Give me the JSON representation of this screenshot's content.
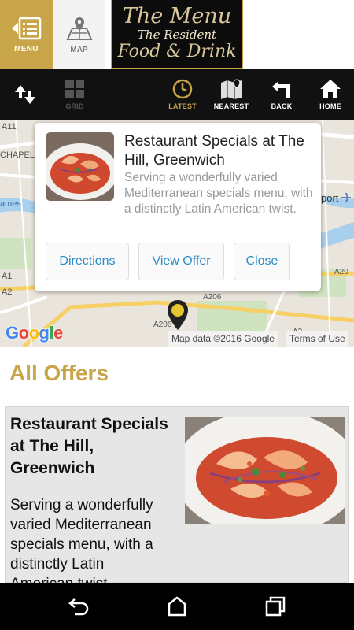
{
  "header": {
    "menu_label": "MENU",
    "map_label": "MAP",
    "logo": {
      "line1": "The Menu",
      "line2": "The Resident",
      "line3": "Food & Drink"
    }
  },
  "toolbar": {
    "grid_label": "GRID",
    "latest_label": "LATEST",
    "nearest_label": "NEAREST",
    "back_label": "BACK",
    "home_label": "HOME"
  },
  "map": {
    "labels": [
      "A11",
      "CHAPEL",
      "ames",
      "A1",
      "A2",
      "port",
      "A206",
      "A2",
      "A206",
      "A20"
    ],
    "google": [
      "G",
      "o",
      "o",
      "g",
      "l",
      "e"
    ],
    "google_colors": [
      "#4285f4",
      "#ea4335",
      "#fbbc05",
      "#4285f4",
      "#34a853",
      "#ea4335"
    ],
    "map_data": "Map data ©2016 Google",
    "terms": "Terms of Use"
  },
  "popup": {
    "title": "Restaurant Specials at The Hill, Greenwich",
    "description": "Serving a wonderfully varied Mediterranean specials menu, with a distinctly Latin American twist.",
    "directions": "Directions",
    "view_offer": "View Offer",
    "close": "Close"
  },
  "offers": {
    "section_title": "All Offers",
    "items": [
      {
        "title": "Restaurant Specials at The Hill, Greenwich",
        "description": "Serving a wonderfully varied Mediterranean specials menu, with a distinctly Latin American twist."
      }
    ]
  },
  "colors": {
    "gold": "#c9a54a",
    "link": "#2a8cc7",
    "toolbar": "#111111"
  }
}
